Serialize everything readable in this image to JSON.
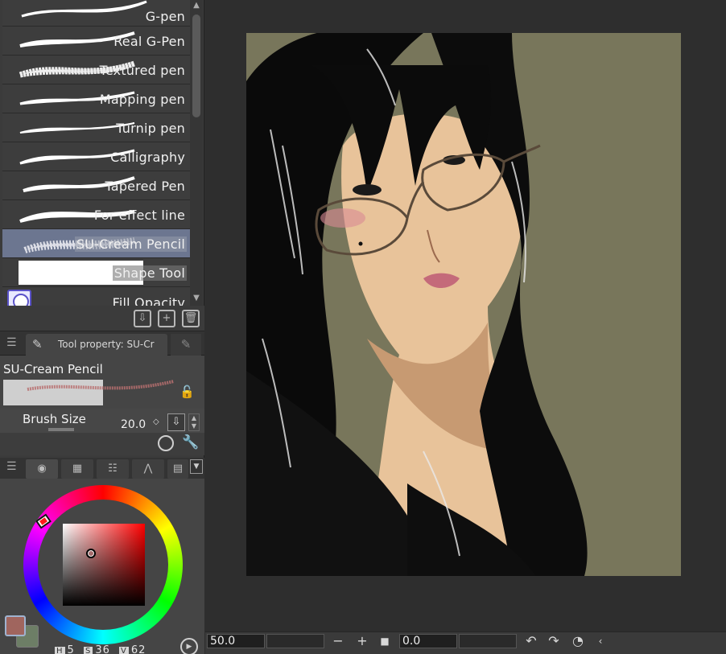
{
  "brush_list": {
    "items": [
      {
        "label": "G-pen",
        "selected": false
      },
      {
        "label": "Real G-Pen",
        "selected": false
      },
      {
        "label": "Textured pen",
        "selected": false
      },
      {
        "label": "Mapping pen",
        "selected": false
      },
      {
        "label": "Turnip pen",
        "selected": false
      },
      {
        "label": "Calligraphy",
        "selected": false
      },
      {
        "label": "Tapered Pen",
        "selected": false
      },
      {
        "label": "For effect line",
        "selected": false
      },
      {
        "label": "SU-Cream Pencil",
        "selected": true
      },
      {
        "label": "Shape Tool",
        "selected": false
      },
      {
        "label": "Fill Opacity",
        "selected": false
      }
    ]
  },
  "tool_property": {
    "tab_title": "Tool property: SU-Cr",
    "tool_name": "SU-Cream Pencil",
    "brush_size_label": "Brush Size",
    "brush_size_value": "20.0"
  },
  "color": {
    "main_color": "#a0655e",
    "sub_color": "#6d7e66",
    "h_key": "H",
    "h_value": "5",
    "s_key": "S",
    "s_value": "36",
    "v_key": "V",
    "v_value": "62"
  },
  "canvas": {
    "background_color": "#78765b"
  },
  "bottom_bar": {
    "zoom_value": "50.0",
    "rotation_value": "0.0",
    "minus": "−",
    "plus": "+"
  }
}
